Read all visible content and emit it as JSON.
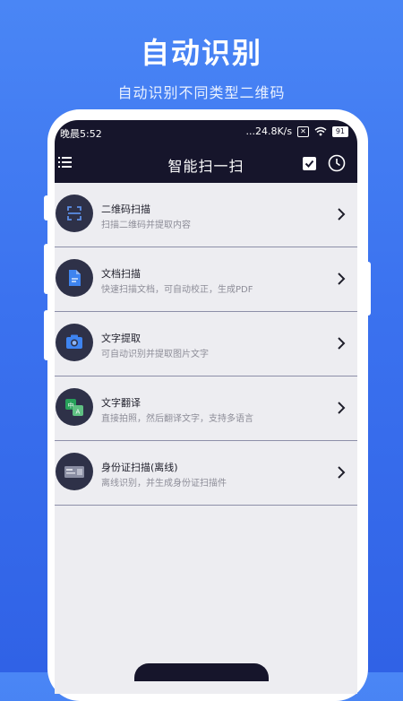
{
  "promo": {
    "title": "自动识别",
    "subtitle": "自动识别不同类型二维码"
  },
  "status_bar": {
    "time": "晚晨5:52",
    "network_speed": "...24.8K/s",
    "sim_label": "✕",
    "battery": "91"
  },
  "app_bar": {
    "title": "智能扫一扫",
    "menu_icon": "list-menu-icon",
    "check_icon": "checkbox-icon",
    "history_icon": "clock-icon"
  },
  "items": [
    {
      "title": "二维码扫描",
      "desc": "扫描二维码并提取内容",
      "icon": "qr-scan-icon"
    },
    {
      "title": "文档扫描",
      "desc": "快速扫描文档，可自动校正，生成PDF",
      "icon": "document-icon"
    },
    {
      "title": "文字提取",
      "desc": "可自动识别并提取图片文字",
      "icon": "camera-icon"
    },
    {
      "title": "文字翻译",
      "desc": "直接拍照，然后翻译文字，支持多语言",
      "icon": "translate-icon"
    },
    {
      "title": "身份证扫描(离线)",
      "desc": "离线识别，并生成身份证扫描件",
      "icon": "id-card-icon"
    }
  ],
  "colors": {
    "background": "#3b72ef",
    "header": "#16152b",
    "icon_circle": "#2e3148",
    "accent_blue": "#3e84f0",
    "translate_green": "#27a05a"
  }
}
